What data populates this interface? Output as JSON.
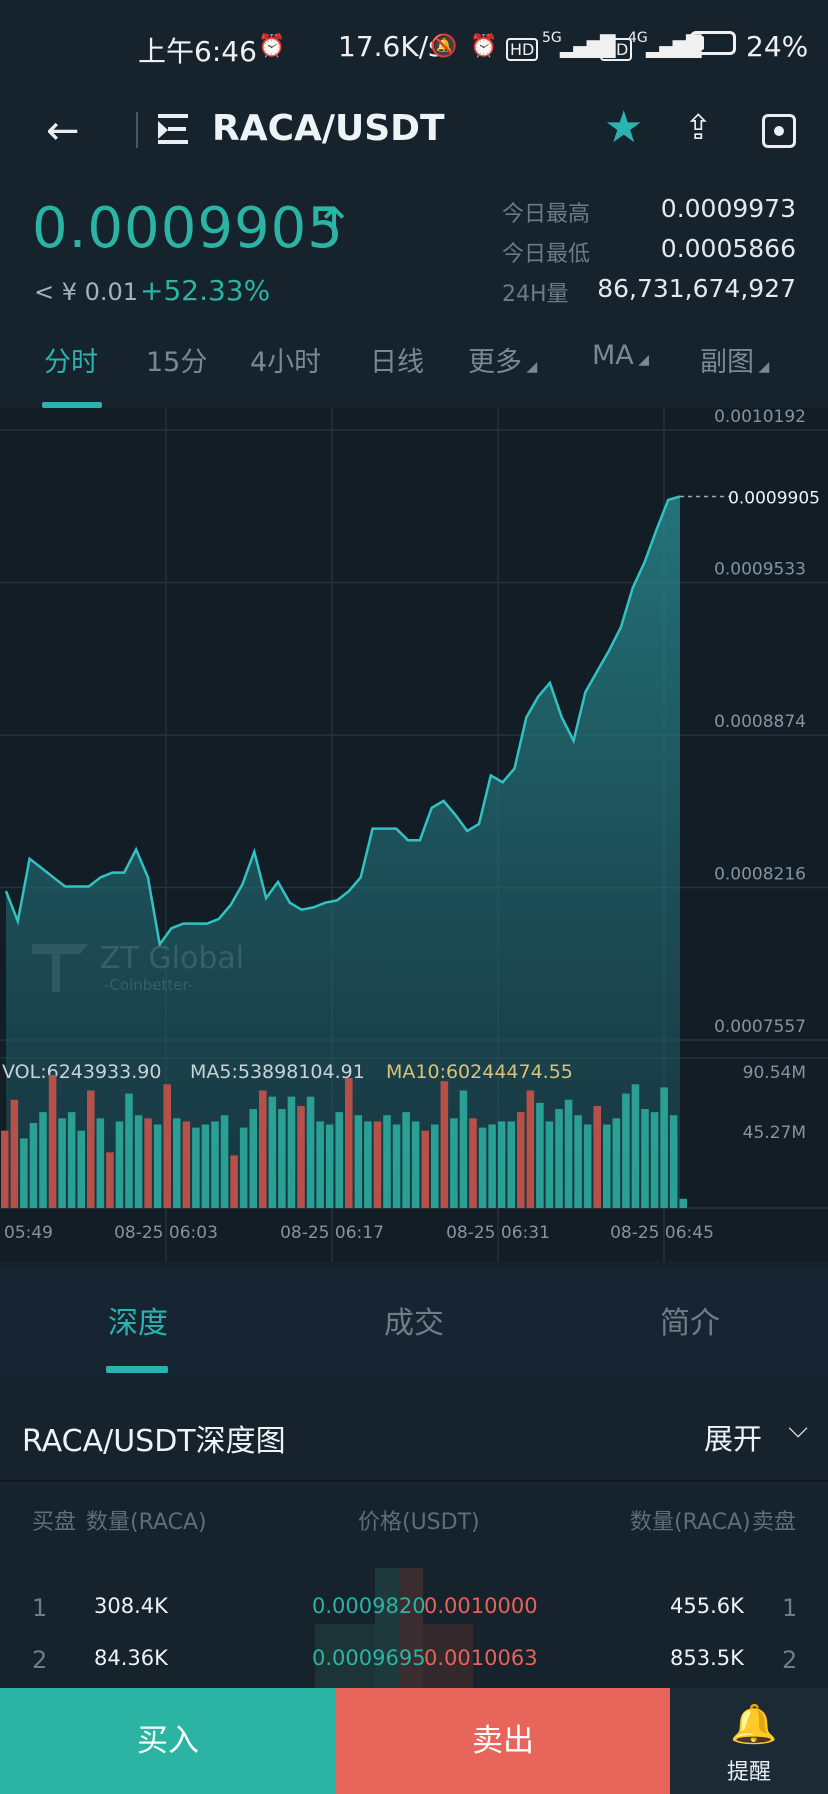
{
  "status": {
    "time": "上午6:46",
    "net_speed": "17.6K/s",
    "hd1": "HD",
    "net1": "5G",
    "hd2": "HD",
    "net2": "4G",
    "battery_pct": "24%",
    "battery_level": 0.24
  },
  "header": {
    "title": "RACA/USDT"
  },
  "ticker": {
    "price": "0.0009905",
    "cny": "< ¥ 0.01",
    "change": "+52.33%",
    "high_label": "今日最高",
    "high": "0.0009973",
    "low_label": "今日最低",
    "low": "0.0005866",
    "vol_label": "24H量",
    "vol": "86,731,674,927"
  },
  "tabs": [
    "分时",
    "15分",
    "4小时",
    "日线",
    "更多",
    "MA",
    "副图"
  ],
  "active_tab": 0,
  "watermark": {
    "brand": "ZT Global",
    "sub": "-Coinbetter-"
  },
  "chart_data": {
    "type": "area",
    "price_axis": {
      "ticks": [
        "0.0010192",
        "0.0009533",
        "0.0008874",
        "0.0008216",
        "0.0007557"
      ],
      "min": 0.0007557,
      "max": 0.0010192,
      "current": "0.0009905"
    },
    "time_labels": [
      "05:49",
      "08-25 06:03",
      "08-25 06:17",
      "08-25 06:31",
      "08-25 06:45"
    ],
    "price_values": [
      0.00082,
      0.000807,
      0.000834,
      0.00083,
      0.000826,
      0.000822,
      0.000822,
      0.000822,
      0.000826,
      0.000828,
      0.000828,
      0.000838,
      0.000826,
      0.000797,
      0.000804,
      0.000806,
      0.000806,
      0.000806,
      0.000808,
      0.000814,
      0.000823,
      0.000837,
      0.000817,
      0.000824,
      0.000815,
      0.000812,
      0.000813,
      0.000815,
      0.000816,
      0.00082,
      0.000826,
      0.000847,
      0.000847,
      0.000847,
      0.000842,
      0.000842,
      0.000856,
      0.000859,
      0.000853,
      0.000846,
      0.000849,
      0.00087,
      0.000867,
      0.000873,
      0.000895,
      0.000904,
      0.00091,
      0.000895,
      0.000885,
      0.000906,
      0.000915,
      0.000924,
      0.000934,
      0.000951,
      0.000962,
      0.000976,
      0.000989,
      0.0009905
    ],
    "volume": {
      "vol": "VOL:6243933.90",
      "ma5": "MA5:53898104.91",
      "ma10": "MA10:60244474.55",
      "axis_top": "90.54M",
      "axis_mid": "45.27M",
      "axis_max": 90.54,
      "bars": [
        {
          "v": 50,
          "c": "r"
        },
        {
          "v": 70,
          "c": "r"
        },
        {
          "v": 45,
          "c": "g"
        },
        {
          "v": 55,
          "c": "g"
        },
        {
          "v": 62,
          "c": "g"
        },
        {
          "v": 86,
          "c": "r"
        },
        {
          "v": 58,
          "c": "g"
        },
        {
          "v": 62,
          "c": "g"
        },
        {
          "v": 50,
          "c": "g"
        },
        {
          "v": 76,
          "c": "r"
        },
        {
          "v": 58,
          "c": "g"
        },
        {
          "v": 36,
          "c": "r"
        },
        {
          "v": 56,
          "c": "g"
        },
        {
          "v": 74,
          "c": "g"
        },
        {
          "v": 60,
          "c": "g"
        },
        {
          "v": 58,
          "c": "r"
        },
        {
          "v": 54,
          "c": "g"
        },
        {
          "v": 80,
          "c": "r"
        },
        {
          "v": 58,
          "c": "g"
        },
        {
          "v": 56,
          "c": "r"
        },
        {
          "v": 52,
          "c": "g"
        },
        {
          "v": 54,
          "c": "g"
        },
        {
          "v": 56,
          "c": "g"
        },
        {
          "v": 60,
          "c": "g"
        },
        {
          "v": 34,
          "c": "r"
        },
        {
          "v": 52,
          "c": "g"
        },
        {
          "v": 64,
          "c": "g"
        },
        {
          "v": 76,
          "c": "r"
        },
        {
          "v": 72,
          "c": "g"
        },
        {
          "v": 64,
          "c": "g"
        },
        {
          "v": 72,
          "c": "g"
        },
        {
          "v": 66,
          "c": "r"
        },
        {
          "v": 72,
          "c": "g"
        },
        {
          "v": 56,
          "c": "g"
        },
        {
          "v": 54,
          "c": "g"
        },
        {
          "v": 62,
          "c": "g"
        },
        {
          "v": 84,
          "c": "r"
        },
        {
          "v": 60,
          "c": "g"
        },
        {
          "v": 56,
          "c": "g"
        },
        {
          "v": 56,
          "c": "r"
        },
        {
          "v": 60,
          "c": "g"
        },
        {
          "v": 54,
          "c": "g"
        },
        {
          "v": 62,
          "c": "g"
        },
        {
          "v": 56,
          "c": "g"
        },
        {
          "v": 50,
          "c": "r"
        },
        {
          "v": 54,
          "c": "g"
        },
        {
          "v": 82,
          "c": "r"
        },
        {
          "v": 58,
          "c": "g"
        },
        {
          "v": 76,
          "c": "g"
        },
        {
          "v": 58,
          "c": "r"
        },
        {
          "v": 52,
          "c": "g"
        },
        {
          "v": 54,
          "c": "g"
        },
        {
          "v": 56,
          "c": "g"
        },
        {
          "v": 56,
          "c": "g"
        },
        {
          "v": 62,
          "c": "r"
        },
        {
          "v": 76,
          "c": "r"
        },
        {
          "v": 68,
          "c": "g"
        },
        {
          "v": 56,
          "c": "g"
        },
        {
          "v": 64,
          "c": "g"
        },
        {
          "v": 70,
          "c": "g"
        },
        {
          "v": 60,
          "c": "g"
        },
        {
          "v": 54,
          "c": "g"
        },
        {
          "v": 66,
          "c": "r"
        },
        {
          "v": 54,
          "c": "g"
        },
        {
          "v": 58,
          "c": "g"
        },
        {
          "v": 74,
          "c": "g"
        },
        {
          "v": 80,
          "c": "g"
        },
        {
          "v": 64,
          "c": "g"
        },
        {
          "v": 62,
          "c": "g"
        },
        {
          "v": 78,
          "c": "g"
        },
        {
          "v": 60,
          "c": "g"
        },
        {
          "v": 6,
          "c": "g"
        }
      ]
    }
  },
  "bottom_tabs": [
    "深度",
    "成交",
    "简介"
  ],
  "depth": {
    "title": "RACA/USDT深度图",
    "expand": "展开",
    "head": {
      "bid": "买盘",
      "bid_qty": "数量(RACA)",
      "price": "价格(USDT)",
      "ask_qty": "数量(RACA)",
      "ask": "卖盘"
    },
    "rows": [
      {
        "idx": "1",
        "bid_qty": "308.4K",
        "bid_price": "0.0009820",
        "ask_price": "0.0010000",
        "ask_qty": "455.6K",
        "ask_idx": "1"
      },
      {
        "idx": "2",
        "bid_qty": "84.36K",
        "bid_price": "0.0009695",
        "ask_price": "0.0010063",
        "ask_qty": "853.5K",
        "ask_idx": "2"
      }
    ]
  },
  "actions": {
    "buy": "买入",
    "sell": "卖出",
    "remind": "提醒"
  },
  "colors": {
    "accent": "#2bb3b1",
    "up": "#2bb3a3",
    "down": "#e8655b",
    "bg": "#16222c"
  }
}
